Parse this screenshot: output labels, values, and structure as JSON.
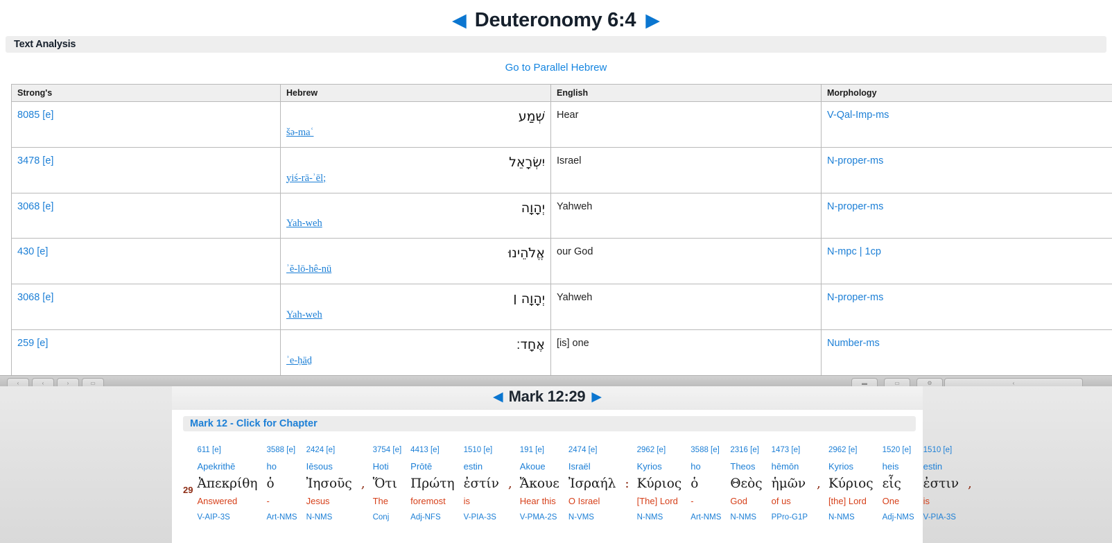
{
  "top": {
    "nav": {
      "prev_icon": "◀",
      "next_icon": "▶",
      "title": "Deuteronomy 6:4"
    },
    "section_title": "Text Analysis",
    "parallel_link": "Go to Parallel Hebrew",
    "table": {
      "headers": [
        "Strong's",
        "Hebrew",
        "English",
        "Morphology"
      ],
      "rows": [
        {
          "strongs": "8085 [e]",
          "hebrew": "שְׁמַע",
          "translit": "šə-maʿ",
          "english": "Hear",
          "morphology": "V-Qal-Imp-ms"
        },
        {
          "strongs": "3478 [e]",
          "hebrew": "יִשְׂרָאֵל",
          "translit": "yiś-rā-ʾēl;",
          "english": "Israel",
          "morphology": "N-proper-ms"
        },
        {
          "strongs": "3068 [e]",
          "hebrew": "יְהָוָה",
          "translit": "Yah-weh",
          "english": "Yahweh",
          "morphology": "N-proper-ms"
        },
        {
          "strongs": "430 [e]",
          "hebrew": "אֱלֹהֵינוּ",
          "translit": "ʾĕ-lō-hê-nū",
          "english": "our God",
          "morphology": "N-mpc | 1cp"
        },
        {
          "strongs": "3068 [e]",
          "hebrew": "יְהָוָה ׀",
          "translit": "Yah-weh",
          "english": "Yahweh",
          "morphology": "N-proper-ms"
        },
        {
          "strongs": "259 [e]",
          "hebrew": "אֶחָד׃",
          "translit": "ʾe-ḥāḏ",
          "english": "[is] one",
          "morphology": "Number-ms"
        }
      ]
    }
  },
  "chrome": {
    "left_buttons": [
      "‹",
      "‹",
      "›",
      "▭"
    ],
    "right_buttons": [
      "▬",
      "▭",
      "⚙",
      "‹"
    ]
  },
  "bottom": {
    "nav": {
      "prev_icon": "◀",
      "next_icon": "▶",
      "title": "Mark 12:29"
    },
    "chapter_link": "Mark 12 - Click for Chapter",
    "verse_number": "29",
    "words": [
      {
        "strongs": "611 [e]",
        "translit": "Apekrithē",
        "greek": "Ἀπεκρίθη",
        "gloss": "Answered",
        "morph": "V-AIP-3S"
      },
      {
        "strongs": "3588 [e]",
        "translit": "ho",
        "greek": "ὁ",
        "gloss": "-",
        "morph": "Art-NMS"
      },
      {
        "strongs": "2424 [e]",
        "translit": "Iēsous",
        "greek": "Ἰησοῦς",
        "gloss": "Jesus",
        "morph": "N-NMS"
      },
      {
        "punct": ","
      },
      {
        "strongs": "3754 [e]",
        "translit": "Hoti",
        "greek": "Ὅτι",
        "gloss": "The",
        "morph": "Conj"
      },
      {
        "strongs": "4413 [e]",
        "translit": "Prōtē",
        "greek": "Πρώτη",
        "gloss": "foremost",
        "morph": "Adj-NFS"
      },
      {
        "strongs": "1510 [e]",
        "translit": "estin",
        "greek": "ἐστίν",
        "gloss": "is",
        "morph": "V-PIA-3S"
      },
      {
        "punct": ","
      },
      {
        "strongs": "191 [e]",
        "translit": "Akoue",
        "greek": "Ἄκουε",
        "gloss": "Hear this",
        "morph": "V-PMA-2S"
      },
      {
        "strongs": "2474 [e]",
        "translit": "Israël",
        "greek": "Ἰσραήλ",
        "gloss": "O Israel",
        "morph": "N-VMS"
      },
      {
        "punct": ":"
      },
      {
        "strongs": "2962 [e]",
        "translit": "Kyrios",
        "greek": "Κύριος",
        "gloss": "[The] Lord",
        "morph": "N-NMS"
      },
      {
        "strongs": "3588 [e]",
        "translit": "ho",
        "greek": "ὁ",
        "gloss": "-",
        "morph": "Art-NMS"
      },
      {
        "strongs": "2316 [e]",
        "translit": "Theos",
        "greek": "Θεὸς",
        "gloss": "God",
        "morph": "N-NMS"
      },
      {
        "strongs": "1473 [e]",
        "translit": "hēmōn",
        "greek": "ἡμῶν",
        "gloss": "of us",
        "morph": "PPro-G1P"
      },
      {
        "punct": ","
      },
      {
        "strongs": "2962 [e]",
        "translit": "Kyrios",
        "greek": "Κύριος",
        "gloss": "[the] Lord",
        "morph": "N-NMS"
      },
      {
        "strongs": "1520 [e]",
        "translit": "heis",
        "greek": "εἷς",
        "gloss": "One",
        "morph": "Adj-NMS"
      },
      {
        "strongs": "1510 [e]",
        "translit": "estin",
        "greek": "ἐστιν",
        "gloss": "is",
        "morph": "V-PIA-3S"
      },
      {
        "punct": ","
      }
    ]
  },
  "colors": {
    "link_blue": "#1c7fd6",
    "gloss_red": "#d6401a",
    "verse_num_red": "#8d2c14",
    "arrow_blue": "#0b76d0"
  }
}
